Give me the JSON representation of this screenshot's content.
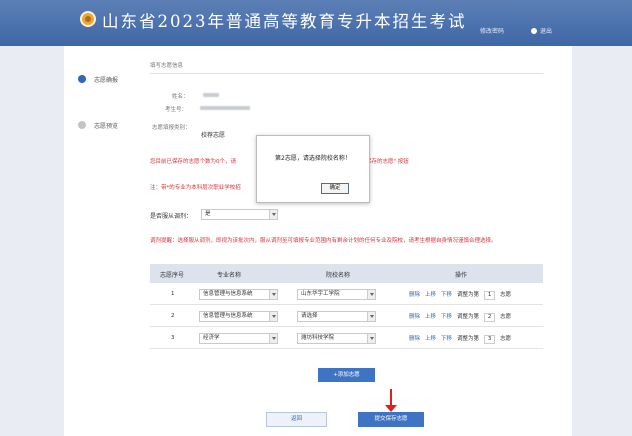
{
  "header": {
    "title": "山东省2023年普通高等教育专升本招生考试",
    "change_password": "修改密码",
    "exit": "退出"
  },
  "steps": [
    {
      "label": "志愿确报",
      "active": true
    },
    {
      "label": "志愿预览",
      "active": false
    }
  ],
  "form": {
    "section_title": "填写志愿信息",
    "name_label": "姓名：",
    "exam_no_label": "考生号：",
    "category_label": "志愿填报类别：",
    "category_label_line2": "",
    "category_value": "校荐志愿",
    "warning1": "您目前已保存的志愿个数为0个，请",
    "warning1_tail": "保存的志愿\" 按钮",
    "warning2": "注：带*的专业为本科层次职业学校招",
    "obey_label": "是否服从调剂：",
    "obey_value": "是",
    "warning3": "调剂提醒：选择服从调剂，即视为该批次内，服从调剂至可填报专业范围内有剩余计划的任何专业及院校，请考生根据自身情况谨慎合理选择。"
  },
  "table": {
    "headers": [
      "志愿序号",
      "专业名称",
      "院校名称",
      "操作"
    ],
    "rows": [
      {
        "seq": "1",
        "major": "信息管理与信息系统",
        "school": "山东华宇工学院",
        "priority": "1"
      },
      {
        "seq": "2",
        "major": "信息管理与信息系统",
        "school": "请选择",
        "priority": "2"
      },
      {
        "seq": "3",
        "major": "经济学",
        "school": "潍坊科技学院",
        "priority": "3"
      }
    ],
    "ops": {
      "delete": "删除",
      "up": "上移",
      "down": "下移",
      "adjust": "调整为第",
      "unit": "志愿"
    }
  },
  "buttons": {
    "add": "+添加志愿",
    "back": "返回",
    "submit": "提交保存志愿"
  },
  "modal": {
    "message": "第2志愿，请选择院校名称！",
    "ok": "确定"
  },
  "colors": {
    "header": "#3e67a6",
    "accent": "#3f73c4",
    "warning": "#d9333a",
    "arrow": "#e02020"
  }
}
